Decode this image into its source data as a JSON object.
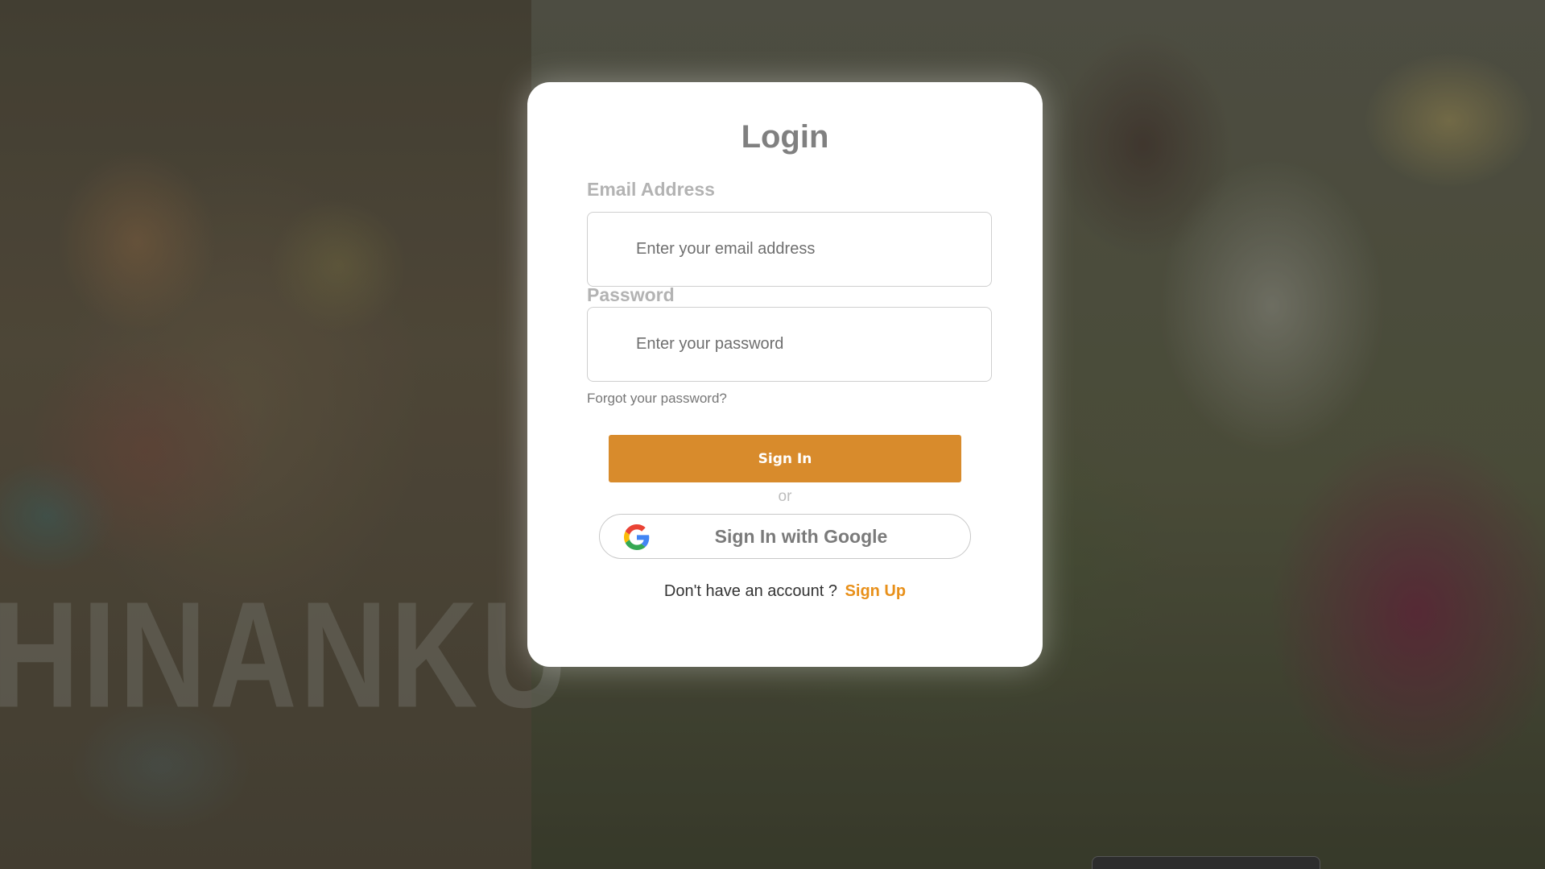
{
  "background": {
    "watermark_text": "HINANKU"
  },
  "login": {
    "title": "Login",
    "email": {
      "label": "Email Address",
      "placeholder": "Enter your email address",
      "value": ""
    },
    "password": {
      "label": "Password",
      "placeholder": "Enter your password",
      "value": ""
    },
    "forgot_password_text": "Forgot your password?",
    "sign_in_label": "Sign In",
    "divider_text": "or",
    "google_button_label": "Sign In with Google",
    "google_icon": "google-g-icon",
    "signup_prompt": "Don't have an account ?",
    "signup_link_text": "Sign Up"
  },
  "colors": {
    "accent": "#d88b2c",
    "signup_link": "#e8901a",
    "title": "#808080",
    "label": "#b3b3b3"
  }
}
